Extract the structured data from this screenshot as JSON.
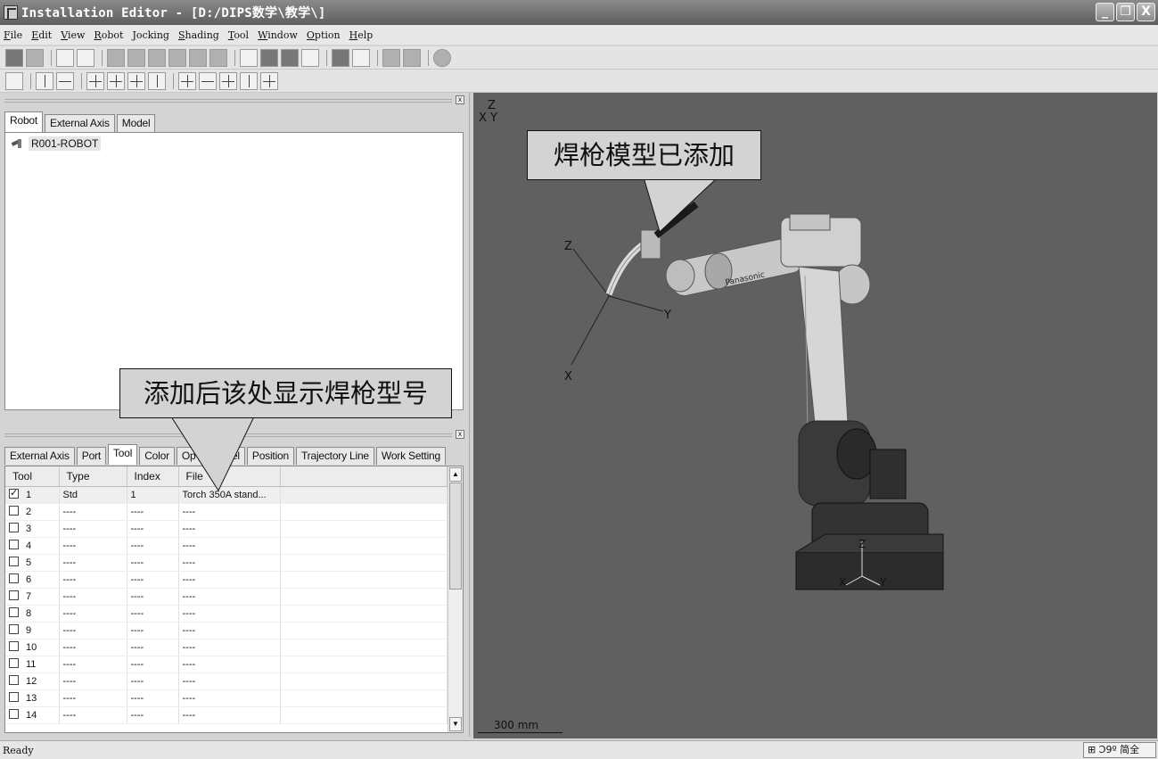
{
  "window": {
    "title": "Installation Editor - [D:/DIPS数学\\教学\\]",
    "buttons": {
      "minimize": "_",
      "restore": "❐",
      "close": "X"
    }
  },
  "menu": [
    "File",
    "Edit",
    "View",
    "Robot",
    "Jocking",
    "Shading",
    "Tool",
    "Window",
    "Option",
    "Help"
  ],
  "top_panel": {
    "tabs": [
      "Robot",
      "External Axis",
      "Model"
    ],
    "active_tab": "Robot",
    "tree_item": "R001-ROBOT",
    "close": "x"
  },
  "bottom_panel": {
    "tabs": [
      "External Axis",
      "Port",
      "Tool",
      "Color",
      "Op",
      "el",
      "Position",
      "Trajectory Line",
      "Work Setting"
    ],
    "active_tab": "Tool",
    "close": "x",
    "columns": [
      "Tool",
      "Type",
      "Index",
      "File"
    ],
    "rows": [
      {
        "tool": "1",
        "type": "Std",
        "index": "1",
        "file": "Torch 350A stand...",
        "checked": true
      },
      {
        "tool": "2",
        "type": "----",
        "index": "----",
        "file": "----",
        "checked": false
      },
      {
        "tool": "3",
        "type": "----",
        "index": "----",
        "file": "----",
        "checked": false
      },
      {
        "tool": "4",
        "type": "----",
        "index": "----",
        "file": "----",
        "checked": false
      },
      {
        "tool": "5",
        "type": "----",
        "index": "----",
        "file": "----",
        "checked": false
      },
      {
        "tool": "6",
        "type": "----",
        "index": "----",
        "file": "----",
        "checked": false
      },
      {
        "tool": "7",
        "type": "----",
        "index": "----",
        "file": "----",
        "checked": false
      },
      {
        "tool": "8",
        "type": "----",
        "index": "----",
        "file": "----",
        "checked": false
      },
      {
        "tool": "9",
        "type": "----",
        "index": "----",
        "file": "----",
        "checked": false
      },
      {
        "tool": "10",
        "type": "----",
        "index": "----",
        "file": "----",
        "checked": false
      },
      {
        "tool": "11",
        "type": "----",
        "index": "----",
        "file": "----",
        "checked": false
      },
      {
        "tool": "12",
        "type": "----",
        "index": "----",
        "file": "----",
        "checked": false
      },
      {
        "tool": "13",
        "type": "----",
        "index": "----",
        "file": "----",
        "checked": false
      },
      {
        "tool": "14",
        "type": "----",
        "index": "----",
        "file": "----",
        "checked": false
      }
    ]
  },
  "viewport": {
    "corner_axes": {
      "z": "Z",
      "x": "X",
      "y": "Y"
    },
    "tool_axes": {
      "z": "Z",
      "y": "Y",
      "x": "X"
    },
    "base_axes": {
      "z": "Z",
      "x": "X",
      "y": "Y"
    },
    "scale_label": "300 mm",
    "robot_brand": "Panasonic"
  },
  "callouts": {
    "torch_added": "焊枪模型已添加",
    "model_shown": "添加后该处显示焊枪型号"
  },
  "status": {
    "text": "Ready",
    "ime": "⊞ Ↄ9º 简全"
  },
  "colors": {
    "viewport_bg": "#606060",
    "robot_body": "#d0d0d0",
    "callout_bg": "#d3d3d3"
  }
}
